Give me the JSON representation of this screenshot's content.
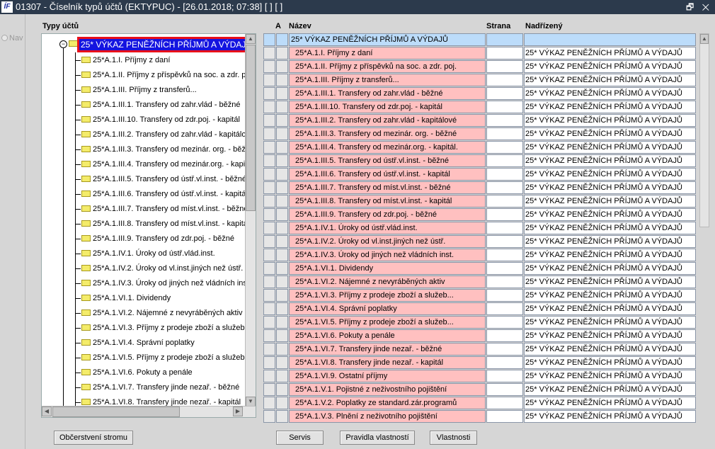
{
  "window": {
    "title": "01307 - Číselník typů účtů (EKTYPUC) - [26.01.2018; 07:38]  [ ]  [ ]",
    "logo": "ÍF",
    "controls": "🗗 ✕"
  },
  "nav": {
    "label": "Nav"
  },
  "tree": {
    "label": "Typy účtů",
    "root": "25* VÝKAZ PENĚŽNÍCH PŘÍJMŮ A VÝDAJŮ",
    "items": [
      "25*A.1.I. Příjmy z daní",
      "25*A.1.II. Příjmy z příspěvků na soc. a zdr. poj.",
      "25*A.1.III. Příjmy z transferů...",
      "25*A.1.III.1. Transfery od zahr.vlád - běžné",
      "25*A.1.III.10. Transfery od zdr.poj. - kapitál",
      "25*A.1.III.2. Transfery od zahr.vlád - kapitálové",
      "25*A.1.III.3. Transfery od mezinár. org. - běžné",
      "25*A.1.III.4. Transfery od mezinár.org. - kapitál.",
      "25*A.1.III.5. Transfery od ústř.vl.inst. - běžné",
      "25*A.1.III.6. Transfery od ústř.vl.inst. - kapitál",
      "25*A.1.III.7. Transfery od míst.vl.inst. - běžné",
      "25*A.1.III.8. Transfery od míst.vl.inst. - kapitál",
      "25*A.1.III.9. Transfery od zdr.poj. - běžné",
      "25*A.1.IV.1. Úroky od ústř.vlád.inst.",
      "25*A.1.IV.2. Úroky od vl.inst.jiných než ústř.",
      "25*A.1.IV.3. Úroky od jiných než vládních inst.",
      "25*A.1.VI.1. Dividendy",
      "25*A.1.VI.2. Nájemné z nevyráběných aktiv",
      "25*A.1.VI.3. Příjmy z prodeje zboží a služeb...",
      "25*A.1.VI.4. Správní poplatky",
      "25*A.1.VI.5. Příjmy z prodeje zboží a služeb...",
      "25*A.1.VI.6. Pokuty a penále",
      "25*A.1.VI.7. Transfery jinde nezař. - běžné",
      "25*A.1.VI.8. Transfery jinde nezař. - kapitál",
      "25*A.1.VI.9. Ostatní příjmy"
    ]
  },
  "grid": {
    "headers": {
      "a": "A",
      "name": "Název",
      "strana": "Strana",
      "parent": "Nadřízený"
    },
    "rows": [
      {
        "name": "25* VÝKAZ PENĚŽNÍCH PŘÍJMŮ A VÝDAJŮ",
        "strana": "",
        "parent": ""
      },
      {
        "name": "25*A.1.I. Příjmy z daní",
        "strana": "",
        "parent": "25* VÝKAZ PENĚŽNÍCH PŘÍJMŮ A VÝDAJŮ"
      },
      {
        "name": "25*A.1.II. Příjmy z příspěvků na soc. a zdr. poj.",
        "strana": "",
        "parent": "25* VÝKAZ PENĚŽNÍCH PŘÍJMŮ A VÝDAJŮ"
      },
      {
        "name": "25*A.1.III. Příjmy z transferů...",
        "strana": "",
        "parent": "25* VÝKAZ PENĚŽNÍCH PŘÍJMŮ A VÝDAJŮ"
      },
      {
        "name": "25*A.1.III.1. Transfery od zahr.vlád - běžné",
        "strana": "",
        "parent": "25* VÝKAZ PENĚŽNÍCH PŘÍJMŮ A VÝDAJŮ"
      },
      {
        "name": "25*A.1.III.10. Transfery od zdr.poj. - kapitál",
        "strana": "",
        "parent": "25* VÝKAZ PENĚŽNÍCH PŘÍJMŮ A VÝDAJŮ"
      },
      {
        "name": "25*A.1.III.2. Transfery od zahr.vlád - kapitálové",
        "strana": "",
        "parent": "25* VÝKAZ PENĚŽNÍCH PŘÍJMŮ A VÝDAJŮ"
      },
      {
        "name": "25*A.1.III.3. Transfery od mezinár. org. - běžné",
        "strana": "",
        "parent": "25* VÝKAZ PENĚŽNÍCH PŘÍJMŮ A VÝDAJŮ"
      },
      {
        "name": "25*A.1.III.4. Transfery od mezinár.org. - kapitál.",
        "strana": "",
        "parent": "25* VÝKAZ PENĚŽNÍCH PŘÍJMŮ A VÝDAJŮ"
      },
      {
        "name": "25*A.1.III.5. Transfery od ústř.vl.inst. - běžné",
        "strana": "",
        "parent": "25* VÝKAZ PENĚŽNÍCH PŘÍJMŮ A VÝDAJŮ"
      },
      {
        "name": "25*A.1.III.6. Transfery od ústř.vl.inst. - kapitál",
        "strana": "",
        "parent": "25* VÝKAZ PENĚŽNÍCH PŘÍJMŮ A VÝDAJŮ"
      },
      {
        "name": "25*A.1.III.7. Transfery od míst.vl.inst. - běžné",
        "strana": "",
        "parent": "25* VÝKAZ PENĚŽNÍCH PŘÍJMŮ A VÝDAJŮ"
      },
      {
        "name": "25*A.1.III.8. Transfery od míst.vl.inst. - kapitál",
        "strana": "",
        "parent": "25* VÝKAZ PENĚŽNÍCH PŘÍJMŮ A VÝDAJŮ"
      },
      {
        "name": "25*A.1.III.9. Transfery od zdr.poj. - běžné",
        "strana": "",
        "parent": "25* VÝKAZ PENĚŽNÍCH PŘÍJMŮ A VÝDAJŮ"
      },
      {
        "name": "25*A.1.IV.1. Úroky od ústř.vlád.inst.",
        "strana": "",
        "parent": "25* VÝKAZ PENĚŽNÍCH PŘÍJMŮ A VÝDAJŮ"
      },
      {
        "name": "25*A.1.IV.2. Úroky od vl.inst.jiných než ústř.",
        "strana": "",
        "parent": "25* VÝKAZ PENĚŽNÍCH PŘÍJMŮ A VÝDAJŮ"
      },
      {
        "name": "25*A.1.IV.3. Úroky od jiných než vládních inst.",
        "strana": "",
        "parent": "25* VÝKAZ PENĚŽNÍCH PŘÍJMŮ A VÝDAJŮ"
      },
      {
        "name": "25*A.1.VI.1. Dividendy",
        "strana": "",
        "parent": "25* VÝKAZ PENĚŽNÍCH PŘÍJMŮ A VÝDAJŮ"
      },
      {
        "name": "25*A.1.VI.2. Nájemné z nevyráběných aktiv",
        "strana": "",
        "parent": "25* VÝKAZ PENĚŽNÍCH PŘÍJMŮ A VÝDAJŮ"
      },
      {
        "name": "25*A.1.VI.3. Příjmy z prodeje zboží a služeb...",
        "strana": "",
        "parent": "25* VÝKAZ PENĚŽNÍCH PŘÍJMŮ A VÝDAJŮ"
      },
      {
        "name": "25*A.1.VI.4. Správní poplatky",
        "strana": "",
        "parent": "25* VÝKAZ PENĚŽNÍCH PŘÍJMŮ A VÝDAJŮ"
      },
      {
        "name": "25*A.1.VI.5. Příjmy z prodeje zboží a služeb...",
        "strana": "",
        "parent": "25* VÝKAZ PENĚŽNÍCH PŘÍJMŮ A VÝDAJŮ"
      },
      {
        "name": "25*A.1.VI.6. Pokuty a penále",
        "strana": "",
        "parent": "25* VÝKAZ PENĚŽNÍCH PŘÍJMŮ A VÝDAJŮ"
      },
      {
        "name": "25*A.1.VI.7. Transfery jinde nezař. - běžné",
        "strana": "",
        "parent": "25* VÝKAZ PENĚŽNÍCH PŘÍJMŮ A VÝDAJŮ"
      },
      {
        "name": "25*A.1.VI.8. Transfery jinde nezař. - kapitál",
        "strana": "",
        "parent": "25* VÝKAZ PENĚŽNÍCH PŘÍJMŮ A VÝDAJŮ"
      },
      {
        "name": "25*A.1.VI.9. Ostatní příjmy",
        "strana": "",
        "parent": "25* VÝKAZ PENĚŽNÍCH PŘÍJMŮ A VÝDAJŮ"
      },
      {
        "name": "25*A.1.V.1. Pojistné z neživostního pojištění",
        "strana": "",
        "parent": "25* VÝKAZ PENĚŽNÍCH PŘÍJMŮ A VÝDAJŮ"
      },
      {
        "name": "25*A.1.V.2. Poplatky ze standard.zár.programů",
        "strana": "",
        "parent": "25* VÝKAZ PENĚŽNÍCH PŘÍJMŮ A VÝDAJŮ"
      },
      {
        "name": "25*A.1.V.3. Plnění z neživotního pojištění",
        "strana": "",
        "parent": "25* VÝKAZ PENĚŽNÍCH PŘÍJMŮ A VÝDAJŮ"
      }
    ]
  },
  "buttons": {
    "refresh": "Občerstvení stromu",
    "service": "Servis",
    "rules": "Pravidla vlastností",
    "props": "Vlastnosti"
  }
}
